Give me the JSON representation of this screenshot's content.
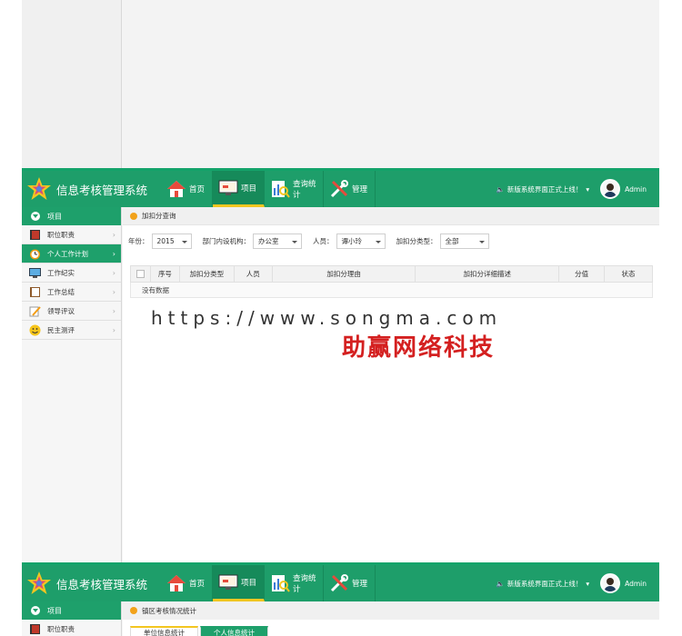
{
  "app": {
    "title": "信息考核管理系统",
    "announcement": "新版系统界面正式上线！",
    "user": "Admin"
  },
  "nav": [
    {
      "label": "首页",
      "icon": "home-icon"
    },
    {
      "label": "项目",
      "icon": "monitor-icon"
    },
    {
      "label": "查询统计",
      "icon": "stats-icon"
    },
    {
      "label": "管理",
      "icon": "tools-icon"
    }
  ],
  "sidebar": {
    "head": "项目",
    "items": [
      {
        "label": "职位职责",
        "icon": "book-icon"
      },
      {
        "label": "个人工作计划",
        "icon": "clock-icon"
      },
      {
        "label": "工作纪实",
        "icon": "monitor-icon"
      },
      {
        "label": "工作总结",
        "icon": "notebook-icon"
      },
      {
        "label": "领导评议",
        "icon": "pencil-icon"
      },
      {
        "label": "民主测评",
        "icon": "smiley-icon"
      }
    ]
  },
  "page": {
    "crumb": "加扣分查询",
    "filters": {
      "year_label": "年份：",
      "year_value": "2015",
      "dept_label": "部门内设机构：",
      "dept_value": "办公室",
      "person_label": "人员：",
      "person_value": "谭小玲",
      "type_label": "加扣分类型：",
      "type_value": "全部"
    },
    "table": {
      "columns": [
        "序号",
        "加扣分类型",
        "人员",
        "加扣分理由",
        "加扣分详细描述",
        "分值",
        "状态"
      ],
      "empty": "没有数据"
    }
  },
  "watermark": {
    "url": "https://www.songma.com",
    "brand": "助赢网络科技"
  },
  "screen2": {
    "crumb": "镇区考核情况统计",
    "tabs": [
      "单位信息统计",
      "个人信息统计"
    ]
  },
  "colors": {
    "primary": "#1ea06b",
    "accent": "#f3c620",
    "watermark": "#d42020"
  }
}
